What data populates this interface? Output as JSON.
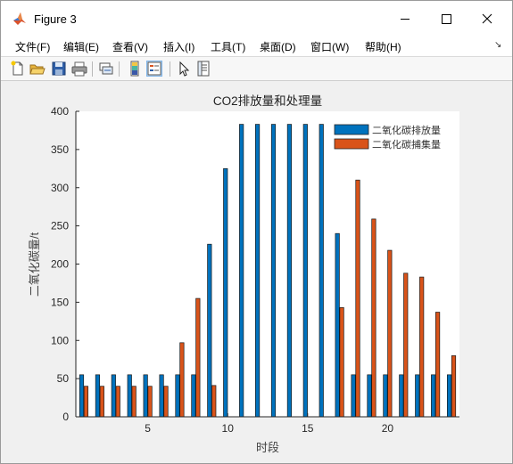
{
  "window": {
    "title": "Figure 3"
  },
  "menu": [
    "文件(F)",
    "编辑(E)",
    "查看(V)",
    "插入(I)",
    "工具(T)",
    "桌面(D)",
    "窗口(W)",
    "帮助(H)"
  ],
  "toolbar": {
    "buttons": [
      "new-figure",
      "open-file",
      "save",
      "print",
      "link",
      "insert-colorbar",
      "insert-legend",
      "select-arrow",
      "property-inspector"
    ]
  },
  "colors": {
    "series1": "#0072BD",
    "series2": "#D95319",
    "plot_bg": "#ffffff",
    "figure_bg": "#f0f0f0"
  },
  "chart_data": {
    "type": "bar",
    "title": "CO2排放量和处理量",
    "xlabel": "时段",
    "ylabel": "二氧化碳量/t",
    "x": [
      1,
      2,
      3,
      4,
      5,
      6,
      7,
      8,
      9,
      10,
      11,
      12,
      13,
      14,
      15,
      16,
      17,
      18,
      19,
      20,
      21,
      22,
      23,
      24
    ],
    "xticks": [
      5,
      10,
      15,
      20
    ],
    "yticks": [
      0,
      50,
      100,
      150,
      200,
      250,
      300,
      350,
      400
    ],
    "xlim": [
      0.5,
      24.5
    ],
    "ylim": [
      0,
      400
    ],
    "legend_position": "top-right",
    "series": [
      {
        "name": "二氧化碳排放量",
        "values": [
          55,
          55,
          55,
          55,
          55,
          55,
          55,
          55,
          226,
          325,
          383,
          383,
          383,
          383,
          383,
          383,
          240,
          55,
          55,
          55,
          55,
          55,
          55,
          55
        ]
      },
      {
        "name": "二氧化碳捕集量",
        "values": [
          40,
          40,
          40,
          40,
          40,
          40,
          97,
          155,
          41,
          0,
          0,
          0,
          0,
          0,
          0,
          0,
          143,
          310,
          259,
          218,
          188,
          183,
          137,
          80
        ]
      }
    ]
  }
}
